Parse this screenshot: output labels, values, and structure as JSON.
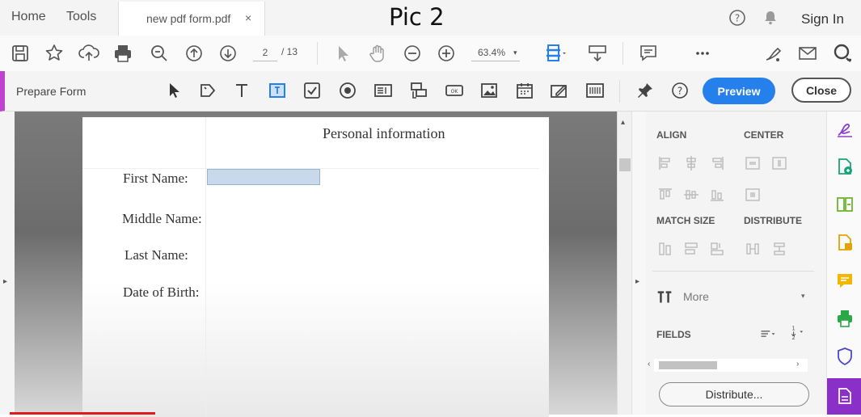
{
  "tabs": {
    "home": "Home",
    "tools": "Tools",
    "document": "new pdf form.pdf",
    "close": "×"
  },
  "overlay_caption": "Pic 2",
  "header": {
    "signin": "Sign In"
  },
  "toolbar": {
    "page_current": "2",
    "page_total": "/ 13",
    "zoom": "63.4%"
  },
  "prepare_form": {
    "title": "Prepare Form",
    "preview": "Preview",
    "close": "Close"
  },
  "document": {
    "heading": "Personal information",
    "fields": [
      "First Name:",
      "Middle Name:",
      "Last Name:",
      "Date of Birth:"
    ]
  },
  "right_panel": {
    "align": "ALIGN",
    "center": "CENTER",
    "match_size": "MATCH SIZE",
    "distribute_title": "DISTRIBUTE",
    "more": "More",
    "fields": "FIELDS",
    "distribute_button": "Distribute..."
  },
  "colors": {
    "accent": "#2680eb",
    "prepare_form": "#c042d0",
    "rail_active": "#8b2fc9"
  },
  "icons": {
    "toolbar": [
      "save-icon",
      "star-icon",
      "upload-icon",
      "print-icon",
      "zoom-search-icon",
      "page-up-icon",
      "page-down-icon",
      "select-arrow-icon",
      "hand-icon",
      "zoom-out-icon",
      "zoom-in-icon",
      "fit-page-icon",
      "scroll-mode-icon",
      "comment-icon",
      "more-icon",
      "sign-icon",
      "email-icon",
      "account-icon"
    ],
    "rail": [
      "fill-sign-icon",
      "export-pdf-icon",
      "organize-pages-icon",
      "edit-pdf-icon",
      "comment-tool-icon",
      "print-production-icon",
      "protect-icon",
      "prepare-form-icon"
    ]
  }
}
